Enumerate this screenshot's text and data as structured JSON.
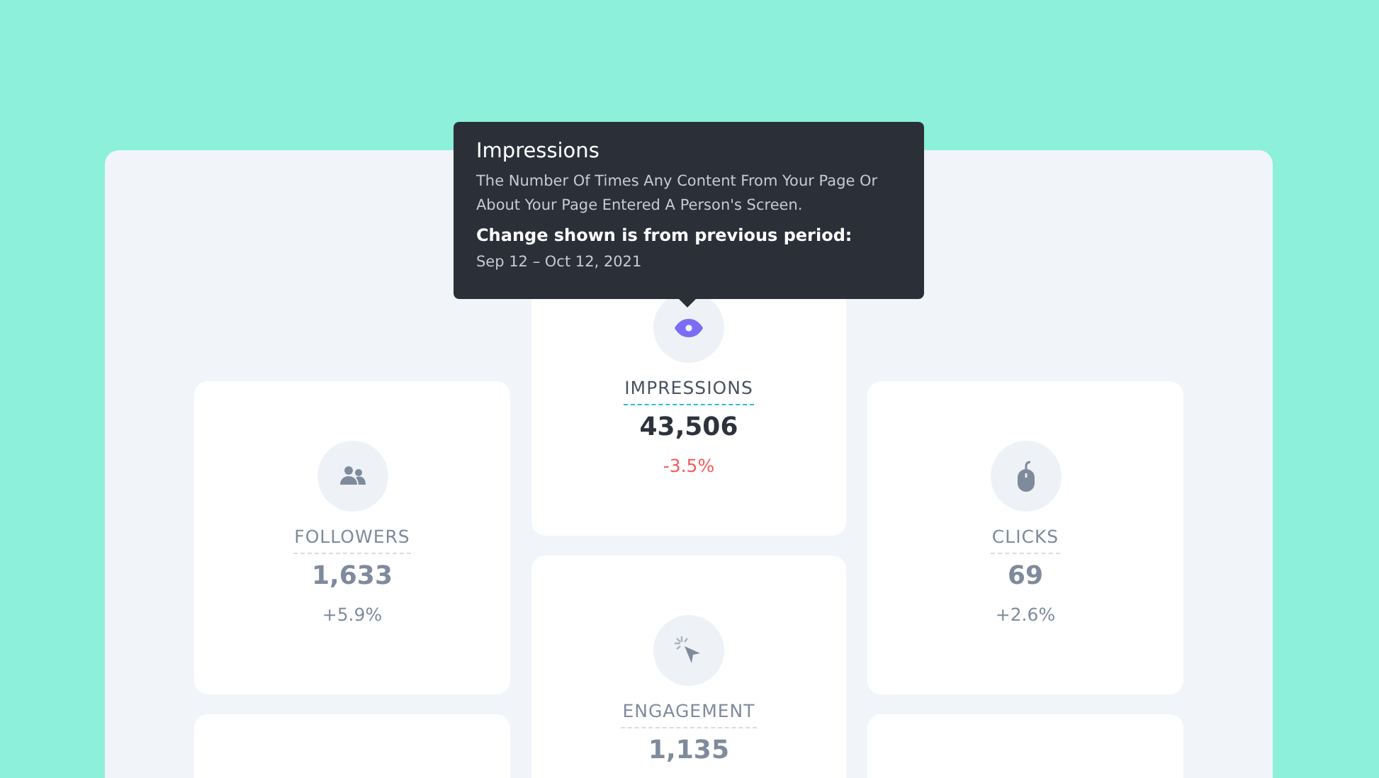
{
  "tooltip": {
    "title": "Impressions",
    "description": "The Number Of Times Any Content From Your Page Or About Your Page Entered A Person's Screen.",
    "period_label": "Change shown is from previous period:",
    "period": "Sep 12 – Oct 12, 2021"
  },
  "columns": [
    {
      "cards": [
        {
          "kind": "users",
          "label": "FOLLOWERS",
          "value": "1,633",
          "change": "+5.9%",
          "selected": false
        }
      ]
    },
    {
      "cards": [
        {
          "kind": "eye",
          "label": "IMPRESSIONS",
          "value": "43,506",
          "change": "-3.5%",
          "selected": true
        },
        {
          "kind": "cursor",
          "label": "ENGAGEMENT",
          "value": "1,135",
          "selected": false
        }
      ]
    },
    {
      "cards": [
        {
          "kind": "mouse",
          "label": "CLICKS",
          "value": "69",
          "change": "+2.6%",
          "selected": false
        }
      ]
    }
  ]
}
